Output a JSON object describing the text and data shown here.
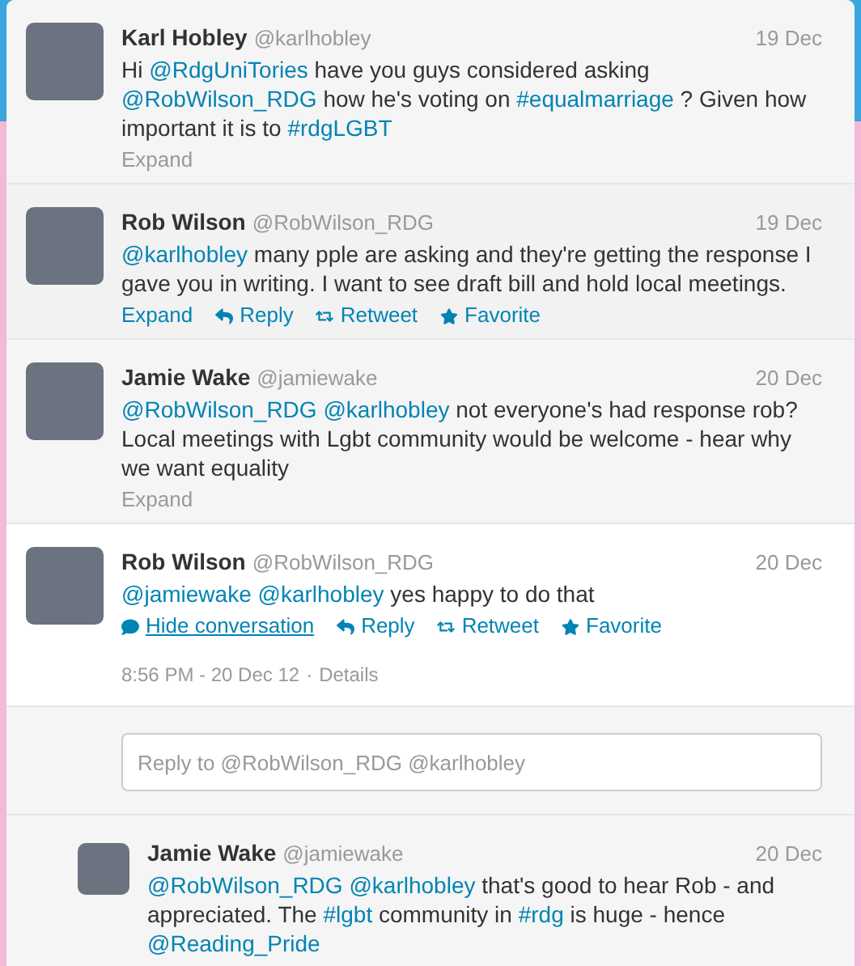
{
  "tweets": [
    {
      "name": "Karl Hobley",
      "handle": "@karlhobley",
      "date": "19 Dec",
      "hovered": false,
      "expanded": false,
      "nested": false,
      "text": [
        {
          "kind": "text",
          "text": "Hi "
        },
        {
          "kind": "link",
          "text": "@RdgUniTories"
        },
        {
          "kind": "text",
          "text": " have you guys considered asking "
        },
        {
          "kind": "link",
          "text": "@RobWilson_RDG"
        },
        {
          "kind": "text",
          "text": " how he's voting on "
        },
        {
          "kind": "link",
          "text": "#equalmarriage"
        },
        {
          "kind": "text",
          "text": " ? Given how important it is to "
        },
        {
          "kind": "link",
          "text": "#rdgLGBT"
        }
      ],
      "actions": [
        {
          "kind": "expand",
          "label": "Expand"
        }
      ]
    },
    {
      "name": "Rob Wilson",
      "handle": "@RobWilson_RDG",
      "date": "19 Dec",
      "hovered": true,
      "expanded": false,
      "nested": false,
      "text": [
        {
          "kind": "link",
          "text": "@karlhobley"
        },
        {
          "kind": "text",
          "text": " many pple are asking and they're getting the response I gave you in writing. I want to see draft bill and hold local meetings."
        }
      ],
      "actions": [
        {
          "kind": "expand",
          "label": "Expand"
        },
        {
          "kind": "reply",
          "label": "Reply"
        },
        {
          "kind": "retweet",
          "label": "Retweet"
        },
        {
          "kind": "favorite",
          "label": "Favorite"
        }
      ]
    },
    {
      "name": "Jamie Wake",
      "handle": "@jamiewake",
      "date": "20 Dec",
      "hovered": false,
      "expanded": false,
      "nested": false,
      "text": [
        {
          "kind": "link",
          "text": "@RobWilson_RDG"
        },
        {
          "kind": "link",
          "text": "@karlhobley"
        },
        {
          "kind": "text",
          "text": " not everyone's had response rob? Local meetings with Lgbt community would be welcome - hear why we want equality"
        }
      ],
      "actions": [
        {
          "kind": "expand",
          "label": "Expand"
        }
      ]
    },
    {
      "name": "Rob Wilson",
      "handle": "@RobWilson_RDG",
      "date": "20 Dec",
      "hovered": true,
      "expanded": true,
      "nested": false,
      "text": [
        {
          "kind": "link",
          "text": "@jamiewake"
        },
        {
          "kind": "link",
          "text": "@karlhobley"
        },
        {
          "kind": "text",
          "text": " yes happy to do that"
        }
      ],
      "actions": [
        {
          "kind": "hide",
          "label": "Hide conversation"
        },
        {
          "kind": "reply",
          "label": "Reply"
        },
        {
          "kind": "retweet",
          "label": "Retweet"
        },
        {
          "kind": "favorite",
          "label": "Favorite"
        }
      ],
      "timestamp": "8:56 PM - 20 Dec 12",
      "separator": "·",
      "details": "Details",
      "reply_box": {
        "placeholder": "Reply to @RobWilson_RDG @karlhobley"
      }
    },
    {
      "name": "Jamie Wake",
      "handle": "@jamiewake",
      "date": "20 Dec",
      "hovered": false,
      "expanded": false,
      "nested": true,
      "text": [
        {
          "kind": "link",
          "text": "@RobWilson_RDG"
        },
        {
          "kind": "link",
          "text": "@karlhobley"
        },
        {
          "kind": "text",
          "text": " that's good to hear Rob - and appreciated. The "
        },
        {
          "kind": "link",
          "text": "#lgbt"
        },
        {
          "kind": "text",
          "text": " community in "
        },
        {
          "kind": "link",
          "text": "#rdg"
        },
        {
          "kind": "text",
          "text": " is huge - hence "
        },
        {
          "kind": "link",
          "text": "@Reading_Pride"
        }
      ]
    }
  ]
}
